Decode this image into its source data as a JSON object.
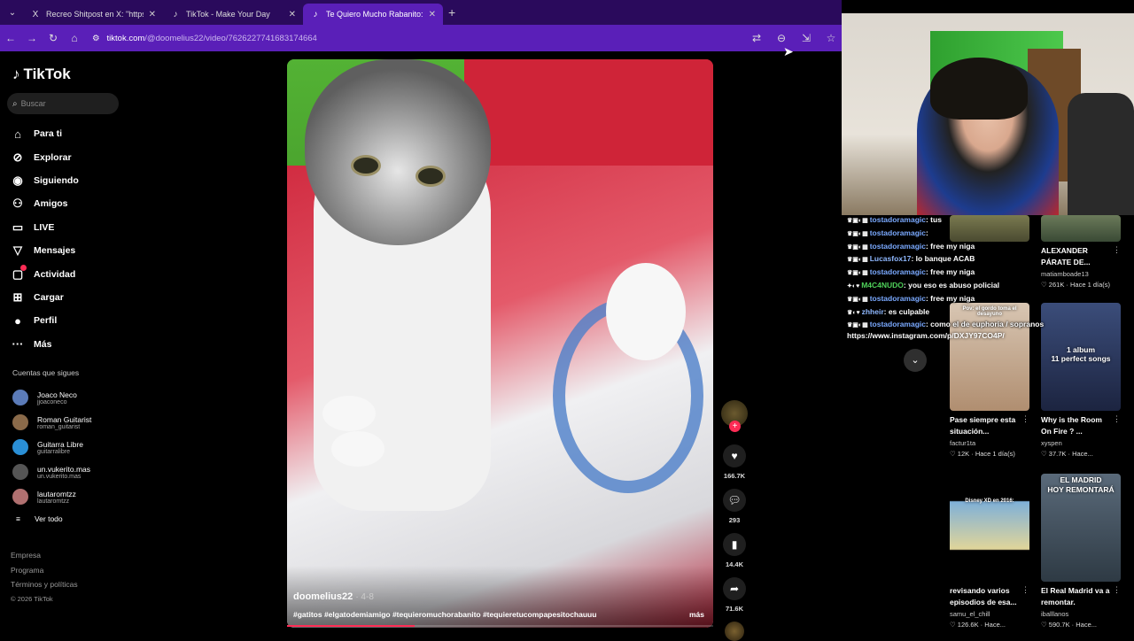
{
  "browser": {
    "tabs": [
      {
        "favicon": "X",
        "title": "Recreo Shitpost en X: \"https://t",
        "active": false
      },
      {
        "favicon": "♪",
        "title": "TikTok - Make Your Day",
        "active": false
      },
      {
        "favicon": "♪",
        "title": "Te Quiero Mucho Rabanito: Un",
        "active": true
      }
    ],
    "new_tab": "+",
    "url_host": "tiktok.com",
    "url_path": "/@doomelius22/video/7626227741683174664"
  },
  "sidebar": {
    "logo": "TikTok",
    "search_placeholder": "Buscar",
    "nav": [
      {
        "label": "Para ti",
        "icon": "⌂"
      },
      {
        "label": "Explorar",
        "icon": "⊘"
      },
      {
        "label": "Siguiendo",
        "icon": "◉"
      },
      {
        "label": "Amigos",
        "icon": "⚇"
      },
      {
        "label": "LIVE",
        "icon": "▭"
      },
      {
        "label": "Mensajes",
        "icon": "▽"
      },
      {
        "label": "Actividad",
        "icon": "▢"
      },
      {
        "label": "Cargar",
        "icon": "⊞"
      },
      {
        "label": "Perfil",
        "icon": "●"
      },
      {
        "label": "Más",
        "icon": "···"
      }
    ],
    "following_header": "Cuentas que sigues",
    "accounts": [
      {
        "name": "Joaco Neco",
        "handle": "jjoaconeco",
        "color": "#5b7bb8"
      },
      {
        "name": "Roman Guitarist",
        "handle": "roman_guitarist",
        "color": "#8a6a4a"
      },
      {
        "name": "Guitarra Libre",
        "handle": "guitarralibre",
        "color": "#2a8fd6"
      },
      {
        "name": "un.vukerito.mas",
        "handle": "un.vukerito.mas",
        "color": "#555"
      },
      {
        "name": "lautaromtzz",
        "handle": "lautaromtzz",
        "color": "#b07070"
      }
    ],
    "see_all": "Ver todo",
    "footer": [
      "Empresa",
      "Programa",
      "Términos y políticas"
    ],
    "copyright": "© 2026 TikTok"
  },
  "video": {
    "author": "doomelius22",
    "date": "· 4-8",
    "hashtags": "#gatitos #elgatodemiamigo #tequieromuchorabanito #tequieretucompapesitochauuu",
    "more": "más",
    "progress": 0.3
  },
  "actions": {
    "likes": "166.7K",
    "comments": "293",
    "saves": "14.4K",
    "shares": "71.6K"
  },
  "chat": {
    "messages": [
      {
        "user": "tostadoramagic",
        "text": ": tus",
        "cls": ""
      },
      {
        "user": "tostadoramagic",
        "text": ":",
        "cls": ""
      },
      {
        "user": "tostadoramagic",
        "text": ": free my niga",
        "cls": ""
      },
      {
        "user": "Lucasfox17",
        "text": ": lo banque ACAB",
        "cls": "blue"
      },
      {
        "user": "tostadoramagic",
        "text": ": free my niga",
        "cls": ""
      },
      {
        "user": "M4C4NUDO",
        "text": ": you eso es abuso policial",
        "cls": "green"
      },
      {
        "user": "tostadoramagic",
        "text": ": free my niga",
        "cls": ""
      },
      {
        "user": "zhheir",
        "text": ": es culpable",
        "cls": "blue"
      },
      {
        "user": "tostadoramagic",
        "text": ": como el de euphoria / sopranos",
        "cls": ""
      }
    ],
    "link": "https://www.instagram.com/p/DXJY97CO4P/"
  },
  "recommendations": [
    {
      "title1": "ALEXANDER",
      "title2": "PÁRATE DE...",
      "author": "matiamboade13",
      "likes": "♡ 261K",
      "time": "Hace 1 día(s)",
      "caption": "",
      "bg": "linear-gradient(180deg,#6b7a5a,#3a4a35)"
    },
    {
      "title1": "Pase siempre esta",
      "title2": "situación...",
      "author": "factur1ta",
      "likes": "♡ 12K",
      "time": "Hace 1 día(s)",
      "caption": "Pov: el gordo toma el desayuno",
      "bg": "linear-gradient(180deg,#d8c6b3,#b08e70)"
    },
    {
      "title1": "Why is the Room",
      "title2": "On Fire ? ...",
      "author": "xyspen",
      "likes": "♡ 37.7K",
      "time": "Hace...",
      "caption": "1 album\n11 perfect songs",
      "bg": "linear-gradient(180deg,#3b4d7a,#1c2440)"
    },
    {
      "title1": "revisando varios",
      "title2": "episodios de esa...",
      "author": "samu_el_chill",
      "likes": "♡ 126.6K",
      "time": "Hace...",
      "caption": "Disney XD en 2016:",
      "bg": "linear-gradient(180deg,#000 0%,#000 25%,#7fb0d8 26%,#e0d59a 70%,#000 71%)"
    },
    {
      "title1": "El Real Madrid va a",
      "title2": "remontar.",
      "author": "iballlanos",
      "likes": "♡ 590.7K",
      "time": "Hace...",
      "caption": "EL MADRID\nHOY REMONTARÁ",
      "bg": "linear-gradient(180deg,#5a6a7a,#2e3a44)"
    }
  ],
  "colors": {
    "tabbar": "#2a0a5c",
    "addrbar": "#5a1fb8",
    "accent": "#fe2c55"
  }
}
